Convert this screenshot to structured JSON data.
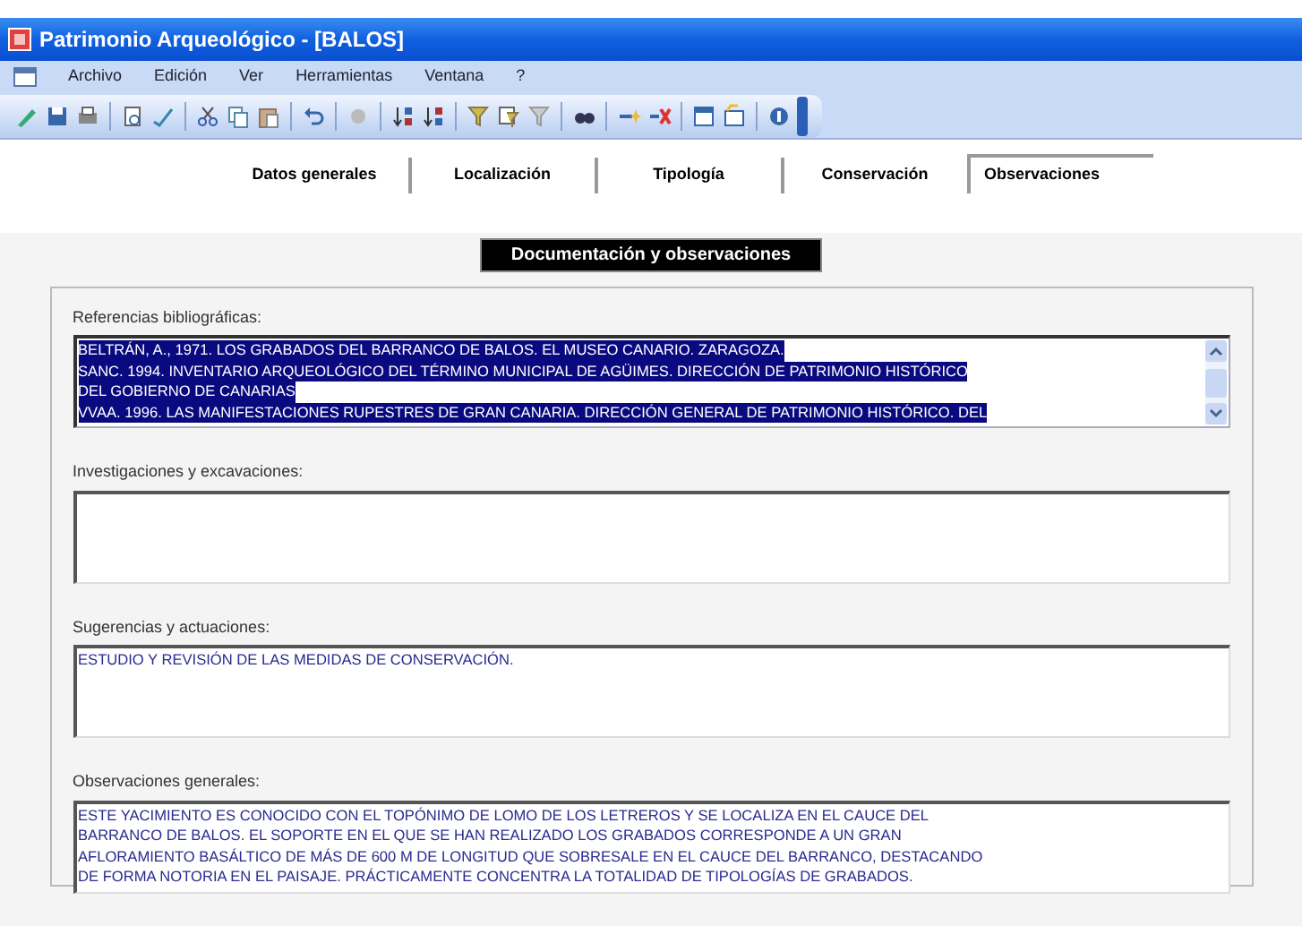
{
  "window": {
    "title": "Patrimonio Arqueológico - [BALOS]"
  },
  "menu": [
    "Archivo",
    "Edición",
    "Ver",
    "Herramientas",
    "Ventana",
    "?"
  ],
  "tabs": [
    {
      "label": "Datos generales",
      "selected": false
    },
    {
      "label": "Localización",
      "selected": false
    },
    {
      "label": "Tipología",
      "selected": false
    },
    {
      "label": "Conservación",
      "selected": false
    },
    {
      "label": "Observaciones",
      "selected": true
    }
  ],
  "section_title": "Documentación y observaciones",
  "fields": [
    {
      "label": "Referencias bibliográficas:",
      "selected": true,
      "scrollbar": true,
      "lines": [
        "BELTRÁN, A., 1971. LOS GRABADOS DEL BARRANCO DE BALOS. EL MUSEO CANARIO. ZARAGOZA.",
        "SANC. 1994. INVENTARIO ARQUEOLÓGICO DEL TÉRMINO MUNICIPAL DE AGÜIMES. DIRECCIÓN DE PATRIMONIO HISTÓRICO",
        "DEL GOBIERNO DE CANARIAS",
        "VVAA. 1996. LAS MANIFESTACIONES RUPESTRES DE GRAN CANARIA. DIRECCIÓN GENERAL DE PATRIMONIO HISTÓRICO. DEL"
      ]
    },
    {
      "label": "Investigaciones y excavaciones:",
      "selected": false,
      "scrollbar": false
    },
    {
      "label": "Sugerencias y actuaciones:",
      "selected": false,
      "scrollbar": false,
      "lines": [
        "ESTUDIO Y REVISIÓN DE LAS MEDIDAS DE CONSERVACIÓN."
      ]
    },
    {
      "label": "Observaciones generales:",
      "selected": false,
      "scrollbar": false,
      "lines": [
        "ESTE YACIMIENTO ES CONOCIDO CON EL TOPÓNIMO DE LOMO DE LOS LETREROS Y SE LOCALIZA EN EL CAUCE DEL",
        "BARRANCO DE BALOS. EL SOPORTE EN EL QUE SE HAN REALIZADO LOS GRABADOS CORRESPONDE A UN GRAN",
        "AFLORAMIENTO BASÁLTICO DE MÁS DE 600 M DE LONGITUD QUE SOBRESALE EN EL CAUCE DEL BARRANCO, DESTACANDO",
        "DE FORMA NOTORIA EN EL PAISAJE. PRÁCTICAMENTE CONCENTRA LA TOTALIDAD DE TIPOLOGÍAS DE GRABADOS."
      ]
    }
  ]
}
